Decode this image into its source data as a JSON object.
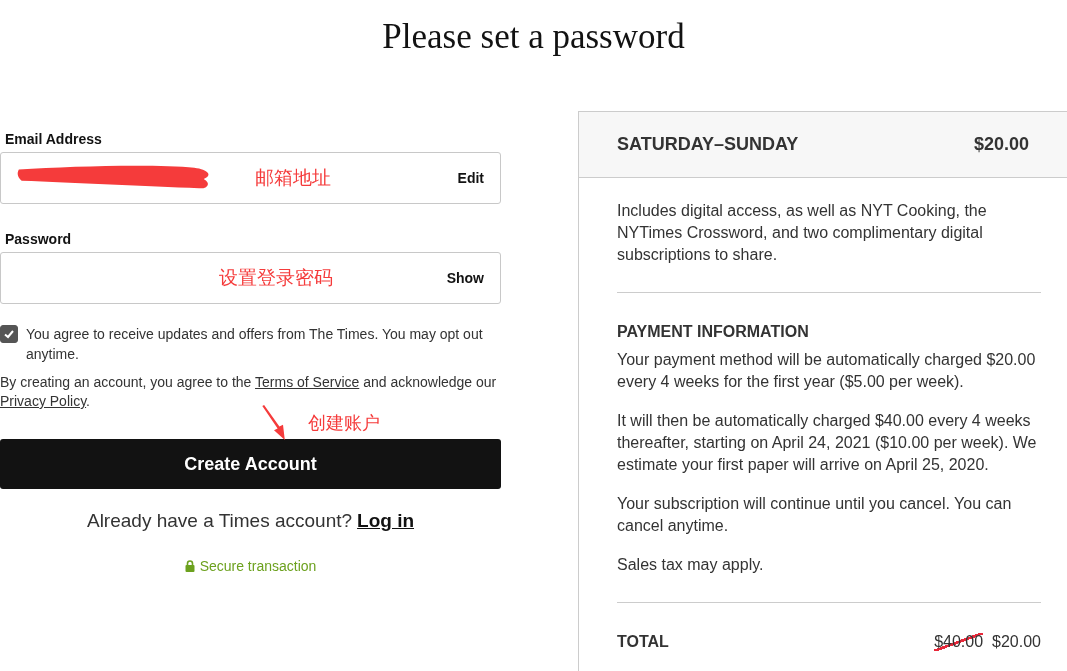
{
  "title": "Please set a password",
  "form": {
    "email": {
      "label": "Email Address",
      "action": "Edit",
      "annotation": "邮箱地址"
    },
    "password": {
      "label": "Password",
      "action": "Show",
      "annotation": "设置登录密码"
    },
    "updates": {
      "checked": true,
      "text": "You agree to receive updates and offers from The Times. You may opt out anytime."
    },
    "legal": [
      {
        "kind": "text",
        "text": "By creating an account, you agree to the "
      },
      {
        "kind": "link",
        "text": "Terms of Service"
      },
      {
        "kind": "text",
        "text": " and acknowledge our "
      },
      {
        "kind": "link",
        "text": "Privacy Policy"
      },
      {
        "kind": "text",
        "text": "."
      }
    ],
    "button_annotation": "创建账户",
    "submit": "Create Account",
    "login_prompt": "Already have a Times account?",
    "login_link": "Log in",
    "secure": "Secure transaction"
  },
  "summary": {
    "plan": "SATURDAY–SUNDAY",
    "price": "$20.00",
    "description": "Includes digital access, as well as NYT Cooking, the NYTimes Crossword, and two complimentary digital subscriptions to share.",
    "payment_heading": "PAYMENT INFORMATION",
    "paragraphs": [
      "Your payment method will be automatically charged $20.00 every 4 weeks for the first year ($5.00 per week).",
      "It will then be automatically charged $40.00 every 4 weeks thereafter, starting on April 24, 2021 ($10.00 per week). We estimate your first paper will arrive on April 25, 2020.",
      "Your subscription will continue until you cancel. You can cancel anytime.",
      "Sales tax may apply."
    ],
    "total_label": "TOTAL",
    "original_total": {
      "text": "$40.00",
      "struck": true
    },
    "total": "$20.00"
  }
}
